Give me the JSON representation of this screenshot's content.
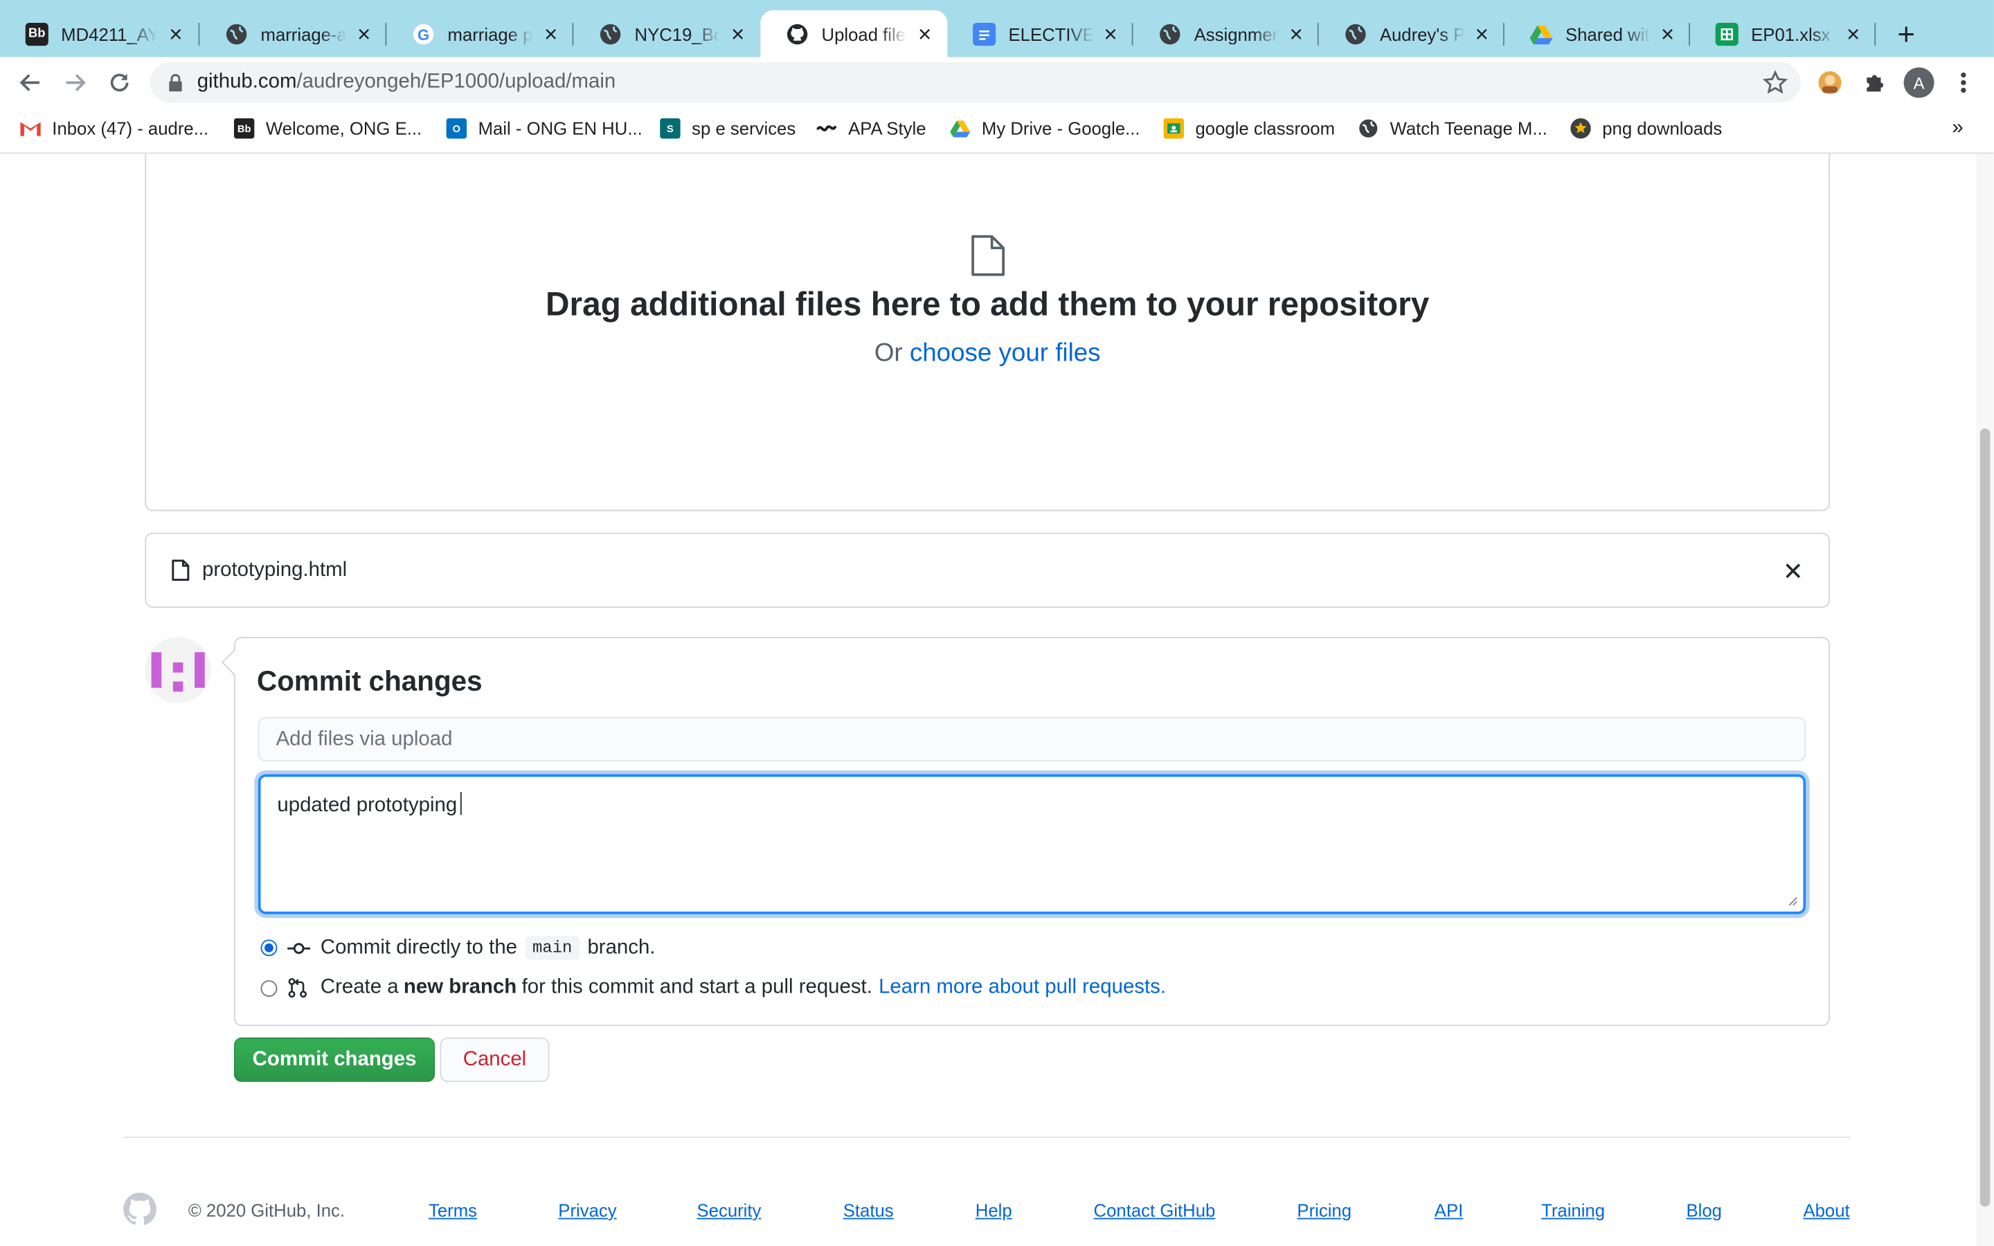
{
  "browser": {
    "tabs": [
      {
        "title": "MD4211_AY2",
        "icon": "blackboard-icon"
      },
      {
        "title": "marriage-an",
        "icon": "globe-icon"
      },
      {
        "title": "marriage psy",
        "icon": "google-icon"
      },
      {
        "title": "NYC19_Book",
        "icon": "globe-icon"
      },
      {
        "title": "Upload files",
        "icon": "github-icon"
      },
      {
        "title": "ELECTIVE D",
        "icon": "google-docs-icon"
      },
      {
        "title": "Assignment",
        "icon": "globe-icon"
      },
      {
        "title": "Audrey's Pro",
        "icon": "globe-icon"
      },
      {
        "title": "Shared with",
        "icon": "google-drive-icon"
      },
      {
        "title": "EP01.xlsx - G",
        "icon": "google-sheets-icon"
      }
    ],
    "active_tab": 4,
    "url_domain": "github.com",
    "url_path": "/audreyongeh/EP1000/upload/main",
    "profile_initial": "A",
    "bookmarks": [
      {
        "label": "Inbox (47) - audre...",
        "icon": "gmail-icon"
      },
      {
        "label": "Welcome, ONG E...",
        "icon": "blackboard-icon"
      },
      {
        "label": "Mail - ONG EN HU...",
        "icon": "outlook-icon"
      },
      {
        "label": "sp e services",
        "icon": "sharepoint-icon"
      },
      {
        "label": "APA Style",
        "icon": "apa-icon"
      },
      {
        "label": "My Drive - Google...",
        "icon": "google-drive-icon"
      },
      {
        "label": "google classroom",
        "icon": "classroom-icon"
      },
      {
        "label": "Watch Teenage M...",
        "icon": "globe-icon"
      },
      {
        "label": "png downloads",
        "icon": "star-badge-icon"
      }
    ],
    "bookmarks_more": "»"
  },
  "upload": {
    "dropzone_heading": "Drag additional files here to add them to your repository",
    "or_text": "Or",
    "choose_link": "choose your files",
    "file_name": "prototyping.html"
  },
  "commit": {
    "heading": "Commit changes",
    "summary_placeholder": "Add files via upload",
    "summary_value": "",
    "description": "updated prototyping",
    "option_direct_prefix": "Commit directly to the",
    "option_direct_branch": "main",
    "option_direct_suffix": "branch.",
    "option_new_prefix": "Create a",
    "option_new_bold": "new branch",
    "option_new_suffix": "for this commit and start a pull request.",
    "option_new_link": "Learn more about pull requests.",
    "selected_option": "direct",
    "commit_button": "Commit changes",
    "cancel_button": "Cancel"
  },
  "footer": {
    "copyright": "© 2020 GitHub, Inc.",
    "links": [
      "Terms",
      "Privacy",
      "Security",
      "Status",
      "Help",
      "Contact GitHub",
      "Pricing",
      "API",
      "Training",
      "Blog",
      "About"
    ]
  },
  "colors": {
    "tabstrip": "#a7dceb",
    "link": "#0366d6",
    "primary_button": "#2ea44f",
    "cancel_text": "#cb2431",
    "focus_ring": "#2188ff"
  }
}
